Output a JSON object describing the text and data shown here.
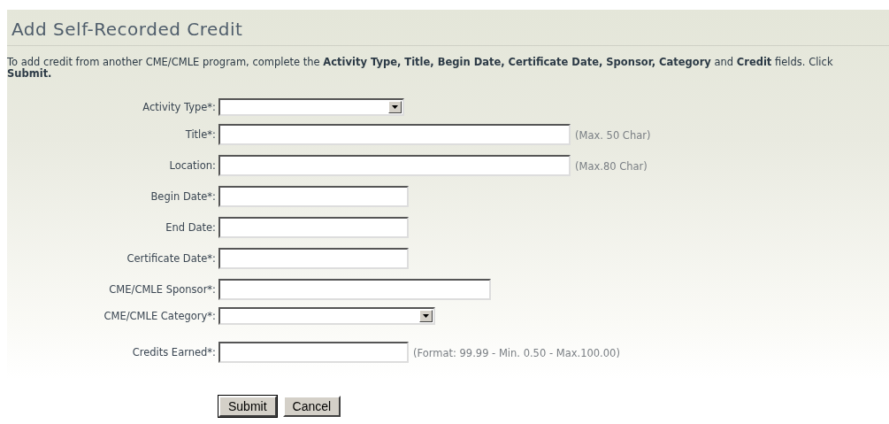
{
  "title": "Add Self-Recorded Credit",
  "intro": "To add credit from another CME/CMLE program, complete the **Activity Type, Title, Begin Date, Certificate Date, Sponsor, Category** and **Credit** fields. Click **Submit.**",
  "fields": [
    {
      "kind": "select",
      "label": "Activity Type*:"
    },
    {
      "kind": "text",
      "label": "Title*:",
      "hint": "(Max. 50 Char)"
    },
    {
      "kind": "text",
      "label": "Location:",
      "hint": "(Max.80 Char)"
    },
    {
      "kind": "text",
      "label": "Begin Date*:"
    },
    {
      "kind": "text",
      "label": "End Date:"
    },
    {
      "kind": "text",
      "label": "Certificate Date*:"
    },
    {
      "kind": "text",
      "label": "CME/CMLE Sponsor*:"
    },
    {
      "kind": "select",
      "label": "CME/CMLE Category*:"
    },
    {
      "kind": "text",
      "label": "Credits Earned*:",
      "hint": "(Format: 99.99 - Min. 0.50 - Max.100.00)"
    }
  ],
  "buttons": [
    "Submit",
    "Cancel"
  ]
}
